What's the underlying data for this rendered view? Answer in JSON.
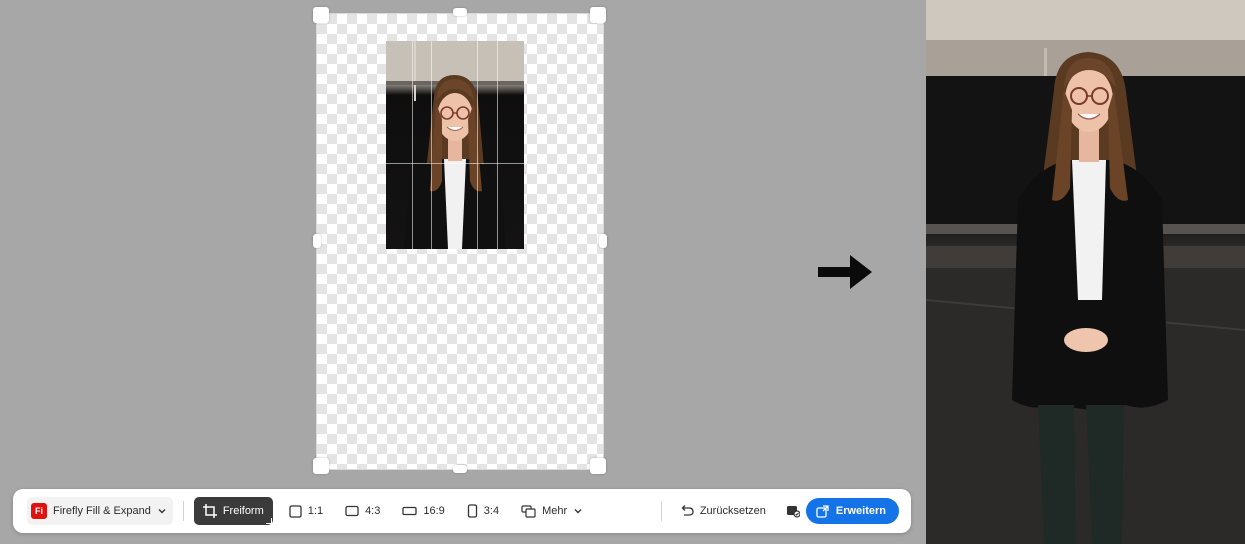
{
  "toolbar": {
    "app_switcher": {
      "badge": "Fi",
      "label": "Firefly Fill & Expand"
    },
    "freeform_label": "Freiform",
    "ratios": [
      {
        "icon": "square-ratio-icon",
        "label": "1:1"
      },
      {
        "icon": "landscape-43-icon",
        "label": "4:3"
      },
      {
        "icon": "wide-169-icon",
        "label": "16:9"
      },
      {
        "icon": "portrait-34-icon",
        "label": "3:4"
      }
    ],
    "more_label": "Mehr",
    "reset_label": "Zurücksetzen",
    "expand_label": "Erweitern"
  },
  "colors": {
    "accent": "#1473e6",
    "app_badge": "#e0120f",
    "selected_tool_bg": "#3b3b3b",
    "workspace_bg": "#a7a7a7"
  },
  "icons": {
    "freeform": "crop-icon",
    "more": "aspect-more-icon",
    "dropdown": "chevron-down-icon",
    "reset": "undo-icon",
    "preview": "image-preview-icon",
    "expand": "expand-icon",
    "next": "arrow-right-icon"
  }
}
